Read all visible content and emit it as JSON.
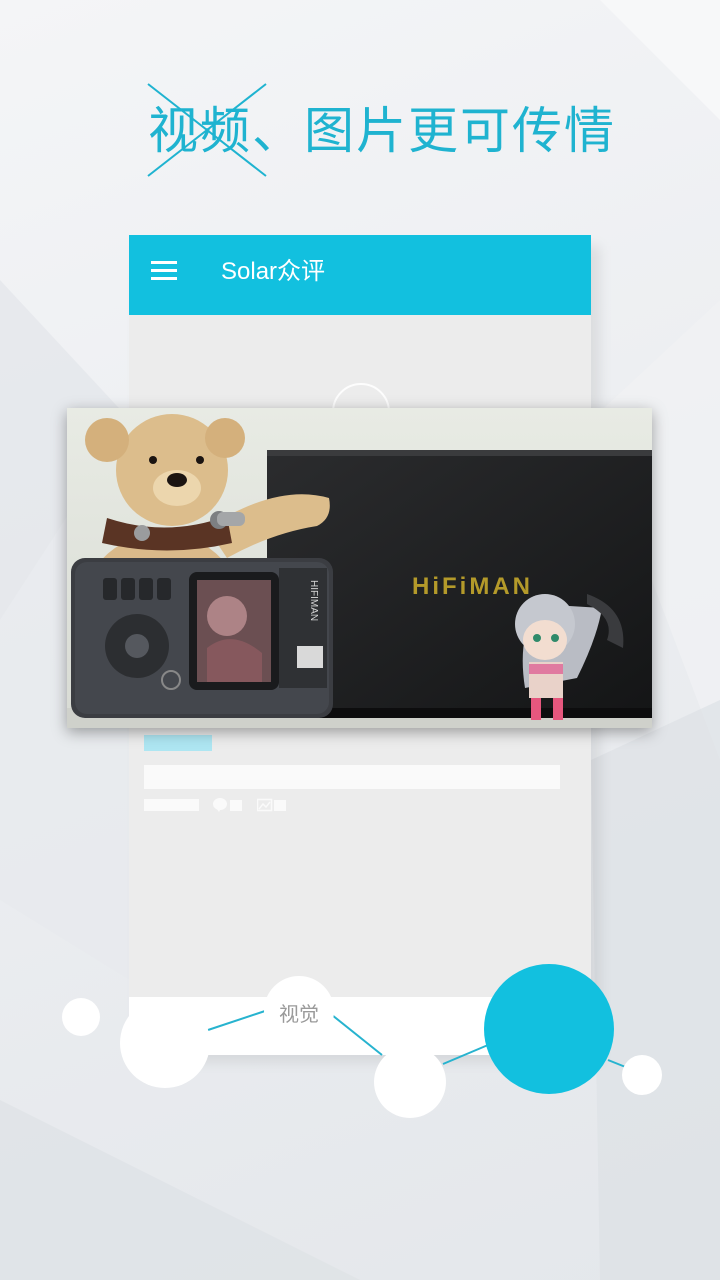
{
  "headline": {
    "struck_text": "视频",
    "text": "、图片更可传情"
  },
  "app": {
    "title": "Solar众评",
    "menu_icon": "hamburger-menu-icon",
    "accent_color": "#12c0df"
  },
  "photo": {
    "brand_box_text": "HiFiMAN",
    "device_brand_text": "HIFIMAN"
  },
  "bubbles": {
    "visual_label": "视觉"
  },
  "colors": {
    "headline": "#1fb3d0",
    "accent_bubble": "#12c0df"
  }
}
